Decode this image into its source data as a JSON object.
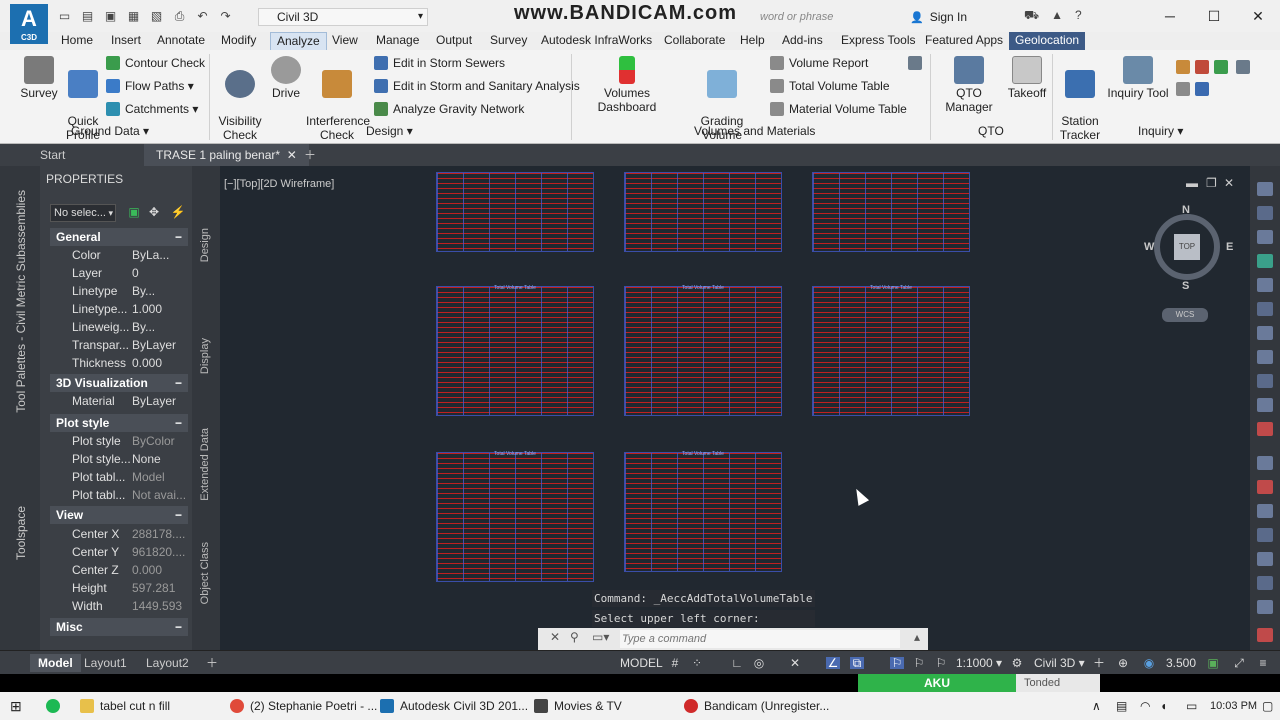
{
  "titlebar": {
    "logo_text": "A",
    "logo_sub": "C3D",
    "workspace": "Civil 3D",
    "watermark": "www.BANDICAM.com",
    "search_placeholder": "word or phrase",
    "sign_in": "Sign In"
  },
  "ribbon_tabs": [
    "Home",
    "Insert",
    "Annotate",
    "Modify",
    "Analyze",
    "View",
    "Manage",
    "Output",
    "Survey",
    "Autodesk InfraWorks",
    "Collaborate",
    "Help",
    "Add-ins",
    "Express Tools",
    "Featured Apps",
    "Geolocation"
  ],
  "ribbon": {
    "survey": "Survey",
    "quick_profile": "Quick\nProfile",
    "contour_check": "Contour Check",
    "flow_paths": "Flow Paths",
    "catchments": "Catchments",
    "ground_data": "Ground Data",
    "visibility_check": "Visibility\nCheck",
    "drive": "Drive",
    "interference_check": "Interference\nCheck",
    "edit_storm_sewers": "Edit in Storm Sewers",
    "edit_storm_sanitary": "Edit in Storm and Sanitary Analysis",
    "analyze_gravity": "Analyze Gravity Network",
    "design": "Design",
    "volumes_dashboard": "Volumes Dashboard",
    "grading_volume_tools": "Grading Volume\nTools",
    "volume_report": "Volume Report",
    "total_volume_table": "Total Volume Table",
    "material_volume_table": "Material Volume Table",
    "volumes_materials": "Volumes and Materials",
    "qto_manager": "QTO Manager",
    "takeoff": "Takeoff",
    "qto": "QTO",
    "station_tracker": "Station\nTracker",
    "inquiry_tool": "Inquiry Tool",
    "inquiry": "Inquiry"
  },
  "file_tabs": {
    "start": "Start",
    "active": "TRASE 1 paling benar*"
  },
  "left_strip": {
    "a": "Tool Palettes - Civil Metric Subassemblies",
    "b": "Toolspace"
  },
  "properties": {
    "title": "PROPERTIES",
    "selection": "No selec...",
    "general": "General",
    "color_k": "Color",
    "color_v": "ByLa...",
    "layer_k": "Layer",
    "layer_v": "0",
    "linetype_k": "Linetype",
    "linetype_v": "By...",
    "ltscale_k": "Linetype...",
    "ltscale_v": "1.000",
    "lweight_k": "Lineweig...",
    "lweight_v": "By...",
    "transp_k": "Transpar...",
    "transp_v": "ByLayer",
    "thick_k": "Thickness",
    "thick_v": "0.000",
    "viz3d": "3D Visualization",
    "material_k": "Material",
    "material_v": "ByLayer",
    "plotstyle": "Plot style",
    "ps_k": "Plot style",
    "ps_v": "ByColor",
    "pst_k": "Plot style...",
    "pst_v": "None",
    "ptab_k": "Plot tabl...",
    "ptab_v": "Model",
    "ptab2_k": "Plot tabl...",
    "ptab2_v": "Not avai...",
    "view": "View",
    "cx_k": "Center X",
    "cx_v": "288178....",
    "cy_k": "Center Y",
    "cy_v": "961820....",
    "cz_k": "Center Z",
    "cz_v": "0.000",
    "h_k": "Height",
    "h_v": "597.281",
    "w_k": "Width",
    "w_v": "1449.593",
    "misc": "Misc"
  },
  "side_tabs": {
    "design": "Design",
    "display": "Display",
    "extended": "Extended Data",
    "object": "Object Class"
  },
  "drawing": {
    "view_label": "[−][Top][2D Wireframe]",
    "table_title": "Total Volume Table",
    "viewcube": {
      "n": "N",
      "s": "S",
      "e": "E",
      "w": "W",
      "top": "TOP",
      "wcs": "WCS"
    },
    "cmd_history": [
      "Command: _AeccAddTotalVolumeTable",
      "Select upper left corner:"
    ],
    "cmd_placeholder": "Type a command"
  },
  "status": {
    "model": "Model",
    "layout1": "Layout1",
    "layout2": "Layout2",
    "model_btn": "MODEL",
    "scale": "1:1000",
    "workspace": "Civil 3D",
    "lw": "3.500"
  },
  "taskbar": {
    "item1": "tabel cut n fill",
    "item2": "(2) Stephanie Poetri - ...",
    "item3": "Autodesk Civil 3D 201...",
    "item4": "Movies & TV",
    "item5": "Bandicam (Unregister...",
    "clock": "10:03 PM",
    "banner": "AKU",
    "banner2": "Tonded"
  }
}
